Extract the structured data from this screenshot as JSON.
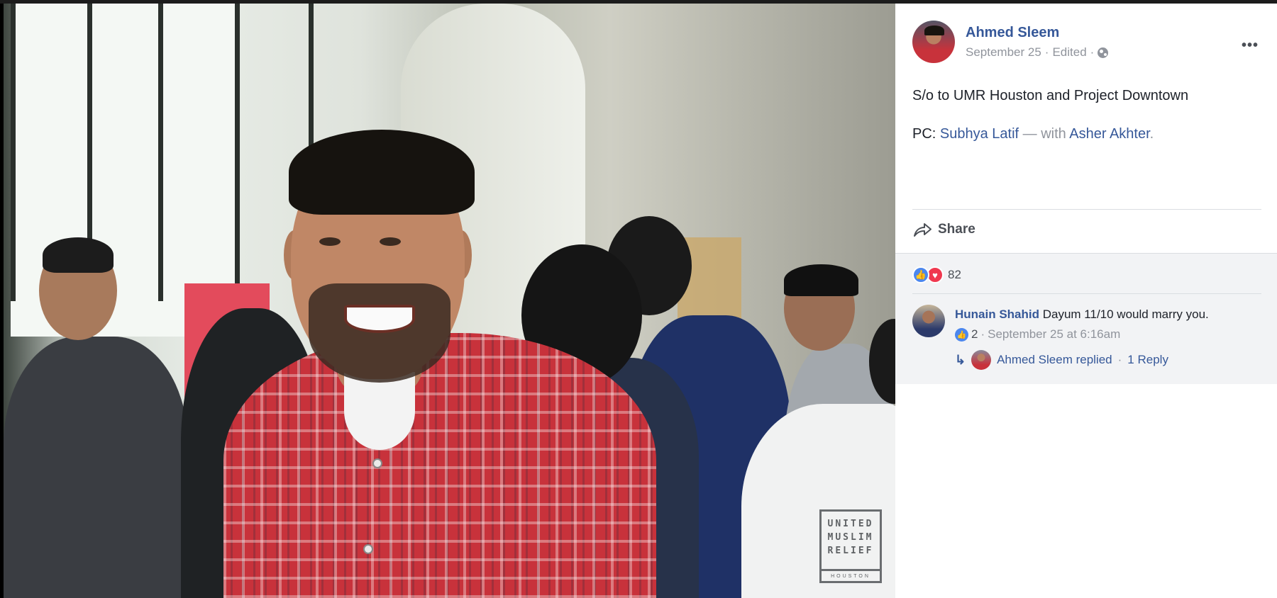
{
  "post": {
    "author": "Ahmed Sleem",
    "date": "September 25",
    "edited": "Edited",
    "separator": "·",
    "text_line1": "S/o to UMR Houston and Project Downtown",
    "pc_prefix": "PC:",
    "pc_name": "Subhya Latif",
    "with_text": "— with",
    "tagged": "Asher Akhter",
    "period": ".",
    "more_glyph": "•••"
  },
  "actions": {
    "share_label": "Share"
  },
  "reactions": {
    "count": "82",
    "types": [
      "like",
      "love"
    ]
  },
  "comment": {
    "author": "Hunain Shahid",
    "text": "Dayum 11/10 would marry you.",
    "likes": "2",
    "time": "September 25 at 6:16am",
    "reply_author_text": "Ahmed Sleem replied",
    "reply_count": "1 Reply"
  },
  "watermark": {
    "line1": "UNITED",
    "line2": "MUSLIM",
    "line3": "RELIEF",
    "sub": "HOUSTON"
  },
  "icons": {
    "share": "share-icon",
    "globe": "globe-icon",
    "like": "like-icon",
    "love": "love-icon",
    "reply": "reply-arrow-icon",
    "more": "more-icon"
  },
  "colors": {
    "link": "#365899",
    "muted": "#90949c",
    "like": "#4c87ee",
    "love": "#f0384f"
  }
}
